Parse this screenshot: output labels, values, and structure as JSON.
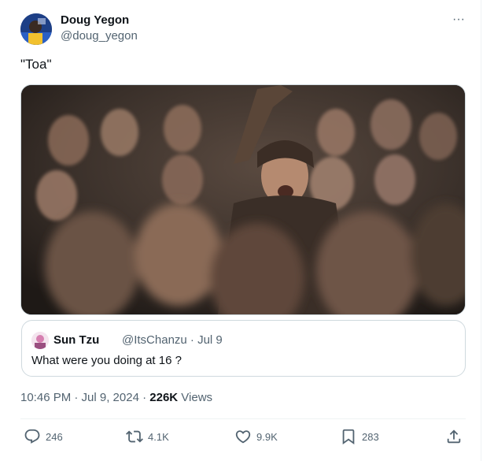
{
  "author": {
    "name": "Doug Yegon",
    "handle": "@doug_yegon"
  },
  "tweet": {
    "text": "\"Toa\""
  },
  "quote": {
    "name": "Sun Tzu",
    "handle_date": "@ItsChanzu · Jul 9",
    "text": "What were you doing at 16 ?"
  },
  "meta": {
    "time_date": "10:46 PM · Jul 9, 2024 · ",
    "views_count": "226K",
    "views_label": " Views"
  },
  "actions": {
    "replies": "246",
    "reposts": "4.1K",
    "likes": "9.9K",
    "bookmarks": "283"
  },
  "menu": {
    "more_symbol": "···"
  },
  "icons": [
    "more-icon",
    "reply-icon",
    "repost-icon",
    "like-icon",
    "bookmark-icon",
    "share-icon"
  ],
  "colors": {
    "text_primary": "#0f1419",
    "text_secondary": "#536471",
    "border": "#cfd9de"
  }
}
